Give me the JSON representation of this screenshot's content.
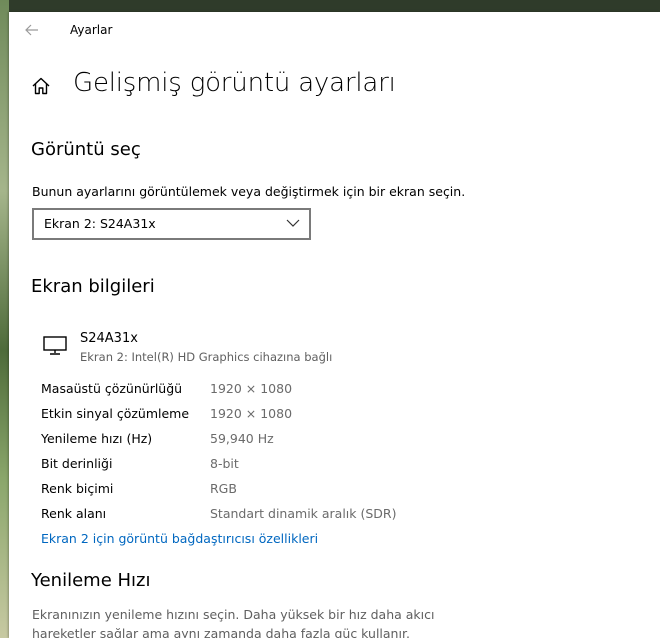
{
  "window": {
    "app_title": "Ayarlar",
    "page_title": "Gelişmiş görüntü ayarları"
  },
  "select_display": {
    "heading": "Görüntü seç",
    "description": "Bunun ayarlarını görüntülemek veya değiştirmek için bir ekran seçin.",
    "selected": "Ekran 2: S24A31x"
  },
  "display_info": {
    "heading": "Ekran bilgileri",
    "monitor_name": "S24A31x",
    "monitor_sub": "Ekran 2: Intel(R) HD Graphics cihazına bağlı",
    "rows": [
      {
        "label": "Masaüstü çözünürlüğü",
        "value": "1920 × 1080"
      },
      {
        "label": "Etkin sinyal çözümleme",
        "value": "1920 × 1080"
      },
      {
        "label": "Yenileme hızı (Hz)",
        "value": "59,940 Hz"
      },
      {
        "label": "Bit derinliği",
        "value": "8-bit"
      },
      {
        "label": "Renk biçimi",
        "value": "RGB"
      },
      {
        "label": "Renk alanı",
        "value": "Standart dinamik aralık (SDR)"
      }
    ],
    "adapter_link": "Ekran 2 için görüntü bağdaştırıcısı özellikleri"
  },
  "refresh_rate": {
    "heading": "Yenileme Hızı",
    "description": "Ekranınızın yenileme hızını seçin. Daha yüksek bir hız daha akıcı hareketler sağlar ama aynı zamanda daha fazla güç kullanır."
  },
  "colors": {
    "accent_link": "#0067c0"
  },
  "icons": {
    "back": "arrow-left-icon",
    "home": "home-icon",
    "chevron": "chevron-down-icon",
    "monitor": "monitor-icon"
  }
}
